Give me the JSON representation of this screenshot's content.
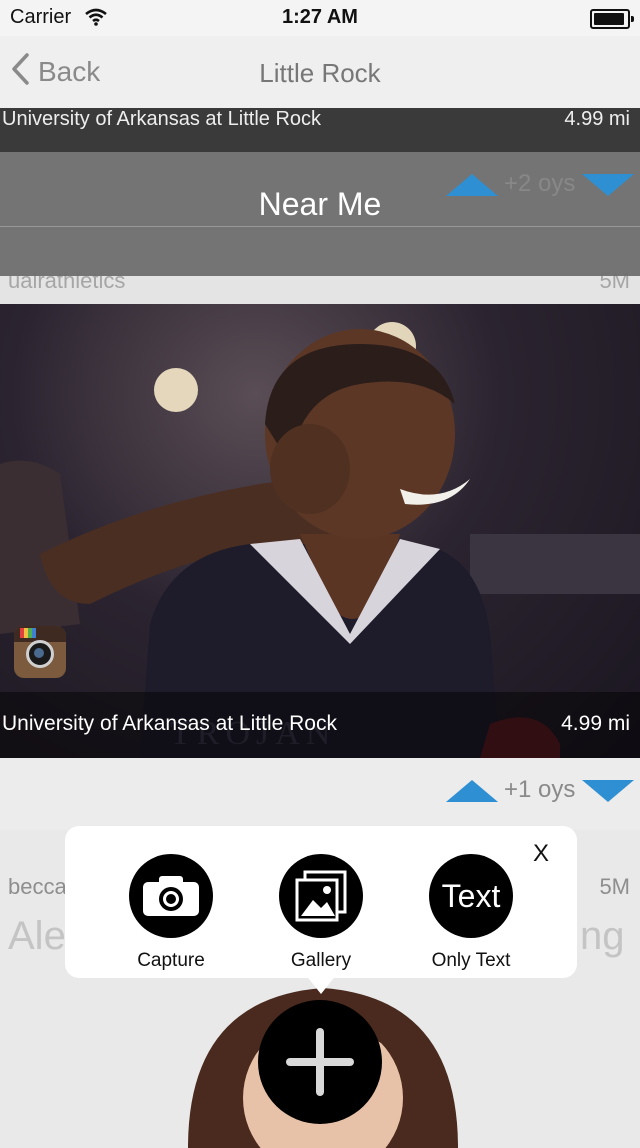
{
  "status_bar": {
    "carrier": "Carrier",
    "time": "1:27 AM"
  },
  "nav": {
    "back_label": "Back",
    "title": "Little Rock"
  },
  "filter": {
    "label": "Near Me",
    "votes": "+2 oys"
  },
  "card0": {
    "caption": "University of Arkansas at Little Rock",
    "distance": "4.99 mi"
  },
  "card1": {
    "username": "ualrathletics",
    "age": "5M",
    "caption": "University of Arkansas at Little Rock",
    "distance": "4.99 mi",
    "votes": "+1 oys",
    "source_icon": "instagram-icon"
  },
  "card2": {
    "username": "becca",
    "age": "5M",
    "text_start": "Ale",
    "text_end": "ng"
  },
  "popup": {
    "close_label": "X",
    "options": [
      {
        "label": "Capture",
        "icon": "camera-icon"
      },
      {
        "label": "Gallery",
        "icon": "gallery-icon"
      },
      {
        "label": "Only Text",
        "icon_text": "Text"
      }
    ]
  },
  "colors": {
    "accent": "#2e8fd2",
    "nav_text": "#8a8a8a"
  }
}
